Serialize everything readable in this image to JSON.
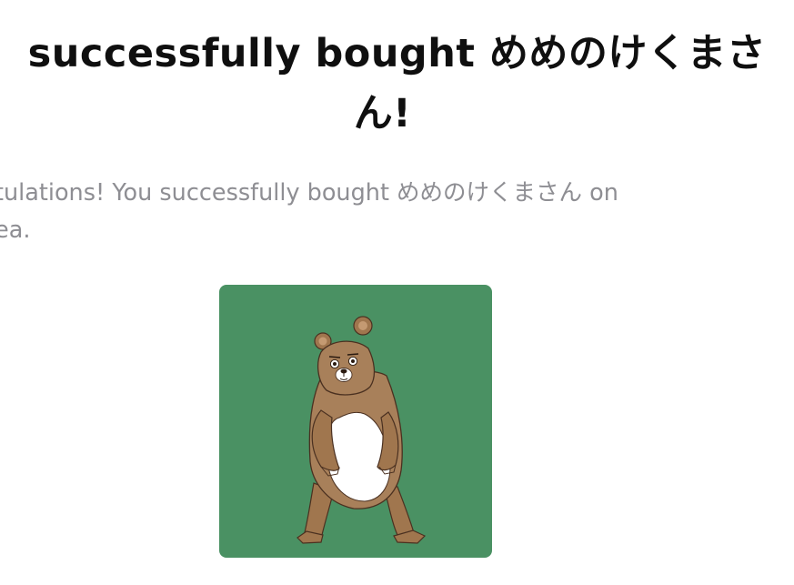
{
  "title": {
    "line1": "successfully bought めめのけくまさ",
    "line2": "ん!"
  },
  "message": {
    "line1": "tulations! You successfully bought めめのけくまさん on",
    "line2": "ea."
  },
  "nft": {
    "image_subject": "bear-illustration",
    "background_color": "#4a9163"
  }
}
